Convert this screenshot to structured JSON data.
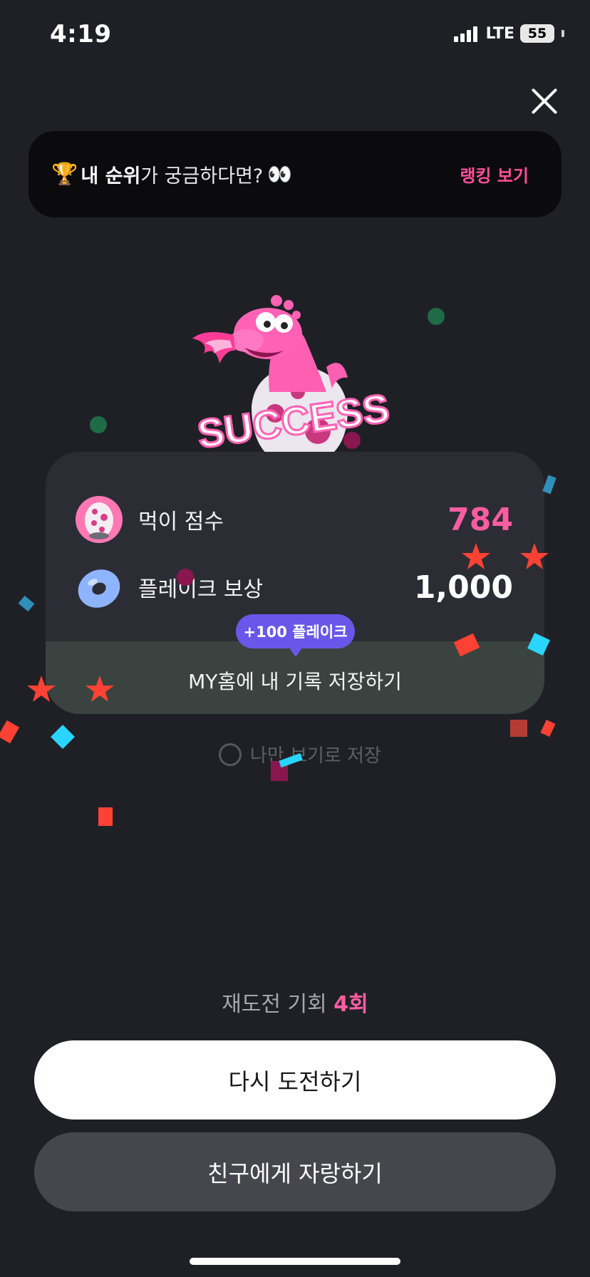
{
  "status_bar": {
    "time": "4:19",
    "network": "LTE",
    "battery": "55"
  },
  "close_icon": "close-icon",
  "ranking_banner": {
    "trophy_icon": "trophy-icon",
    "highlight": "내 순위",
    "text": "가 궁금하다면?",
    "eyes_icon": "eyes-icon",
    "link": "랭킹 보기"
  },
  "mascot": {
    "badge_text": "SUCCESS"
  },
  "result_card": {
    "score": {
      "label": "먹이 점수",
      "value": "784",
      "icon": "egg-icon"
    },
    "reward": {
      "label": "플레이크 보상",
      "value": "1,000",
      "icon": "donut-icon"
    },
    "tooltip": "+100 플레이크",
    "save_label": "MY홈에 내 기록 저장하기"
  },
  "private_option": {
    "label": "나만 보기로 저장"
  },
  "retry": {
    "label": "재도전 기회",
    "count": "4회"
  },
  "buttons": {
    "retry": "다시 도전하기",
    "share": "친구에게 자랑하기"
  },
  "colors": {
    "accent_pink": "#ff5da2",
    "tooltip_purple": "#6a57ea",
    "background": "#1f2026"
  }
}
